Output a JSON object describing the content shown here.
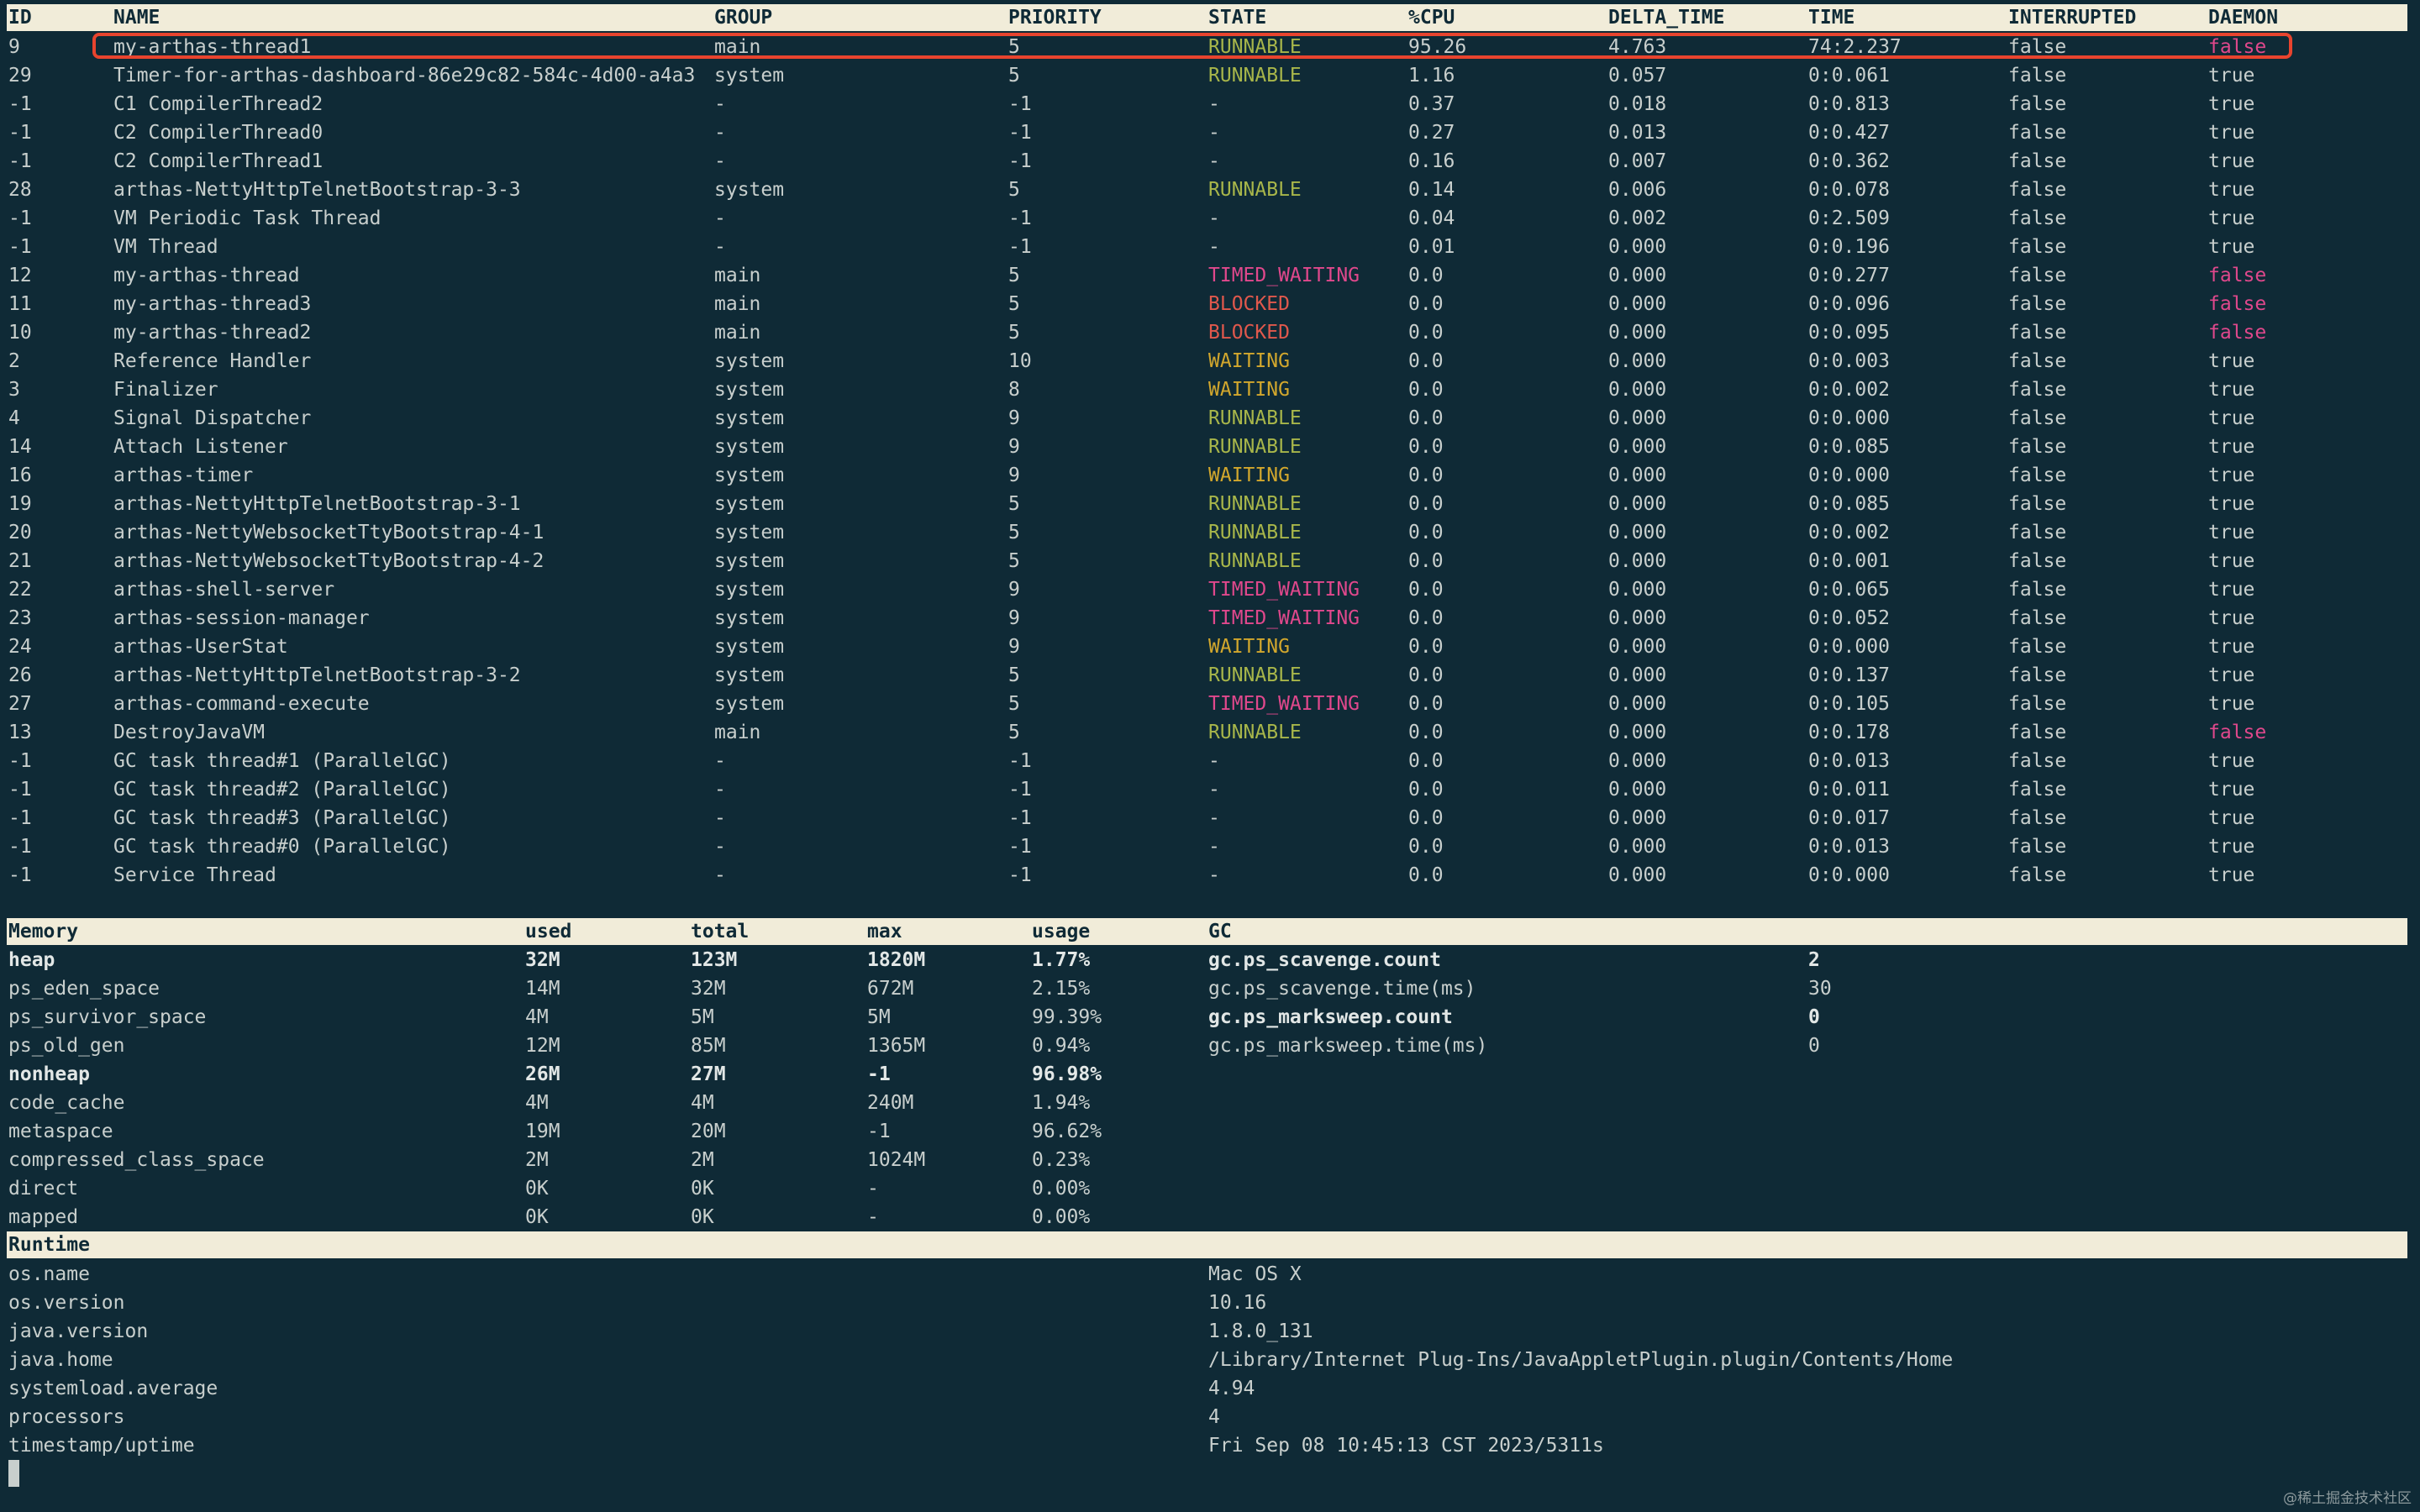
{
  "thread_table": {
    "headers": {
      "id": "ID",
      "name": "NAME",
      "group": "GROUP",
      "priority": "PRIORITY",
      "state": "STATE",
      "cpu": "%CPU",
      "delta_time": "DELTA_TIME",
      "time": "TIME",
      "interrupted": "INTERRUPTED",
      "daemon": "DAEMON"
    },
    "selected_row_index": 0,
    "rows": [
      {
        "id": "9",
        "name": "my-arthas-thread1",
        "group": "main",
        "priority": "5",
        "state": "RUNNABLE",
        "cpu": "95.26",
        "delta_time": "4.763",
        "time": "74:2.237",
        "interrupted": "false",
        "daemon": "false"
      },
      {
        "id": "29",
        "name": "Timer-for-arthas-dashboard-86e29c82-584c-4d00-a4a3",
        "group": "system",
        "priority": "5",
        "state": "RUNNABLE",
        "cpu": "1.16",
        "delta_time": "0.057",
        "time": "0:0.061",
        "interrupted": "false",
        "daemon": "true"
      },
      {
        "id": "-1",
        "name": "C1 CompilerThread2",
        "group": "-",
        "priority": "-1",
        "state": "-",
        "cpu": "0.37",
        "delta_time": "0.018",
        "time": "0:0.813",
        "interrupted": "false",
        "daemon": "true"
      },
      {
        "id": "-1",
        "name": "C2 CompilerThread0",
        "group": "-",
        "priority": "-1",
        "state": "-",
        "cpu": "0.27",
        "delta_time": "0.013",
        "time": "0:0.427",
        "interrupted": "false",
        "daemon": "true"
      },
      {
        "id": "-1",
        "name": "C2 CompilerThread1",
        "group": "-",
        "priority": "-1",
        "state": "-",
        "cpu": "0.16",
        "delta_time": "0.007",
        "time": "0:0.362",
        "interrupted": "false",
        "daemon": "true"
      },
      {
        "id": "28",
        "name": "arthas-NettyHttpTelnetBootstrap-3-3",
        "group": "system",
        "priority": "5",
        "state": "RUNNABLE",
        "cpu": "0.14",
        "delta_time": "0.006",
        "time": "0:0.078",
        "interrupted": "false",
        "daemon": "true"
      },
      {
        "id": "-1",
        "name": "VM Periodic Task Thread",
        "group": "-",
        "priority": "-1",
        "state": "-",
        "cpu": "0.04",
        "delta_time": "0.002",
        "time": "0:2.509",
        "interrupted": "false",
        "daemon": "true"
      },
      {
        "id": "-1",
        "name": "VM Thread",
        "group": "-",
        "priority": "-1",
        "state": "-",
        "cpu": "0.01",
        "delta_time": "0.000",
        "time": "0:0.196",
        "interrupted": "false",
        "daemon": "true"
      },
      {
        "id": "12",
        "name": "my-arthas-thread",
        "group": "main",
        "priority": "5",
        "state": "TIMED_WAITING",
        "cpu": "0.0",
        "delta_time": "0.000",
        "time": "0:0.277",
        "interrupted": "false",
        "daemon": "false"
      },
      {
        "id": "11",
        "name": "my-arthas-thread3",
        "group": "main",
        "priority": "5",
        "state": "BLOCKED",
        "cpu": "0.0",
        "delta_time": "0.000",
        "time": "0:0.096",
        "interrupted": "false",
        "daemon": "false"
      },
      {
        "id": "10",
        "name": "my-arthas-thread2",
        "group": "main",
        "priority": "5",
        "state": "BLOCKED",
        "cpu": "0.0",
        "delta_time": "0.000",
        "time": "0:0.095",
        "interrupted": "false",
        "daemon": "false"
      },
      {
        "id": "2",
        "name": "Reference Handler",
        "group": "system",
        "priority": "10",
        "state": "WAITING",
        "cpu": "0.0",
        "delta_time": "0.000",
        "time": "0:0.003",
        "interrupted": "false",
        "daemon": "true"
      },
      {
        "id": "3",
        "name": "Finalizer",
        "group": "system",
        "priority": "8",
        "state": "WAITING",
        "cpu": "0.0",
        "delta_time": "0.000",
        "time": "0:0.002",
        "interrupted": "false",
        "daemon": "true"
      },
      {
        "id": "4",
        "name": "Signal Dispatcher",
        "group": "system",
        "priority": "9",
        "state": "RUNNABLE",
        "cpu": "0.0",
        "delta_time": "0.000",
        "time": "0:0.000",
        "interrupted": "false",
        "daemon": "true"
      },
      {
        "id": "14",
        "name": "Attach Listener",
        "group": "system",
        "priority": "9",
        "state": "RUNNABLE",
        "cpu": "0.0",
        "delta_time": "0.000",
        "time": "0:0.085",
        "interrupted": "false",
        "daemon": "true"
      },
      {
        "id": "16",
        "name": "arthas-timer",
        "group": "system",
        "priority": "9",
        "state": "WAITING",
        "cpu": "0.0",
        "delta_time": "0.000",
        "time": "0:0.000",
        "interrupted": "false",
        "daemon": "true"
      },
      {
        "id": "19",
        "name": "arthas-NettyHttpTelnetBootstrap-3-1",
        "group": "system",
        "priority": "5",
        "state": "RUNNABLE",
        "cpu": "0.0",
        "delta_time": "0.000",
        "time": "0:0.085",
        "interrupted": "false",
        "daemon": "true"
      },
      {
        "id": "20",
        "name": "arthas-NettyWebsocketTtyBootstrap-4-1",
        "group": "system",
        "priority": "5",
        "state": "RUNNABLE",
        "cpu": "0.0",
        "delta_time": "0.000",
        "time": "0:0.002",
        "interrupted": "false",
        "daemon": "true"
      },
      {
        "id": "21",
        "name": "arthas-NettyWebsocketTtyBootstrap-4-2",
        "group": "system",
        "priority": "5",
        "state": "RUNNABLE",
        "cpu": "0.0",
        "delta_time": "0.000",
        "time": "0:0.001",
        "interrupted": "false",
        "daemon": "true"
      },
      {
        "id": "22",
        "name": "arthas-shell-server",
        "group": "system",
        "priority": "9",
        "state": "TIMED_WAITING",
        "cpu": "0.0",
        "delta_time": "0.000",
        "time": "0:0.065",
        "interrupted": "false",
        "daemon": "true"
      },
      {
        "id": "23",
        "name": "arthas-session-manager",
        "group": "system",
        "priority": "9",
        "state": "TIMED_WAITING",
        "cpu": "0.0",
        "delta_time": "0.000",
        "time": "0:0.052",
        "interrupted": "false",
        "daemon": "true"
      },
      {
        "id": "24",
        "name": "arthas-UserStat",
        "group": "system",
        "priority": "9",
        "state": "WAITING",
        "cpu": "0.0",
        "delta_time": "0.000",
        "time": "0:0.000",
        "interrupted": "false",
        "daemon": "true"
      },
      {
        "id": "26",
        "name": "arthas-NettyHttpTelnetBootstrap-3-2",
        "group": "system",
        "priority": "5",
        "state": "RUNNABLE",
        "cpu": "0.0",
        "delta_time": "0.000",
        "time": "0:0.137",
        "interrupted": "false",
        "daemon": "true"
      },
      {
        "id": "27",
        "name": "arthas-command-execute",
        "group": "system",
        "priority": "5",
        "state": "TIMED_WAITING",
        "cpu": "0.0",
        "delta_time": "0.000",
        "time": "0:0.105",
        "interrupted": "false",
        "daemon": "true"
      },
      {
        "id": "13",
        "name": "DestroyJavaVM",
        "group": "main",
        "priority": "5",
        "state": "RUNNABLE",
        "cpu": "0.0",
        "delta_time": "0.000",
        "time": "0:0.178",
        "interrupted": "false",
        "daemon": "false"
      },
      {
        "id": "-1",
        "name": "GC task thread#1 (ParallelGC)",
        "group": "-",
        "priority": "-1",
        "state": "-",
        "cpu": "0.0",
        "delta_time": "0.000",
        "time": "0:0.013",
        "interrupted": "false",
        "daemon": "true"
      },
      {
        "id": "-1",
        "name": "GC task thread#2 (ParallelGC)",
        "group": "-",
        "priority": "-1",
        "state": "-",
        "cpu": "0.0",
        "delta_time": "0.000",
        "time": "0:0.011",
        "interrupted": "false",
        "daemon": "true"
      },
      {
        "id": "-1",
        "name": "GC task thread#3 (ParallelGC)",
        "group": "-",
        "priority": "-1",
        "state": "-",
        "cpu": "0.0",
        "delta_time": "0.000",
        "time": "0:0.017",
        "interrupted": "false",
        "daemon": "true"
      },
      {
        "id": "-1",
        "name": "GC task thread#0 (ParallelGC)",
        "group": "-",
        "priority": "-1",
        "state": "-",
        "cpu": "0.0",
        "delta_time": "0.000",
        "time": "0:0.013",
        "interrupted": "false",
        "daemon": "true"
      },
      {
        "id": "-1",
        "name": "Service Thread",
        "group": "-",
        "priority": "-1",
        "state": "-",
        "cpu": "0.0",
        "delta_time": "0.000",
        "time": "0:0.000",
        "interrupted": "false",
        "daemon": "true"
      }
    ]
  },
  "memory_table": {
    "headers": {
      "memory": "Memory",
      "used": "used",
      "total": "total",
      "max": "max",
      "usage": "usage"
    },
    "rows": [
      {
        "name": "heap",
        "used": "32M",
        "total": "123M",
        "max": "1820M",
        "usage": "1.77%",
        "bold": true
      },
      {
        "name": "ps_eden_space",
        "used": "14M",
        "total": "32M",
        "max": "672M",
        "usage": "2.15%",
        "bold": false
      },
      {
        "name": "ps_survivor_space",
        "used": "4M",
        "total": "5M",
        "max": "5M",
        "usage": "99.39%",
        "bold": false
      },
      {
        "name": "ps_old_gen",
        "used": "12M",
        "total": "85M",
        "max": "1365M",
        "usage": "0.94%",
        "bold": false
      },
      {
        "name": "nonheap",
        "used": "26M",
        "total": "27M",
        "max": "-1",
        "usage": "96.98%",
        "bold": true
      },
      {
        "name": "code_cache",
        "used": "4M",
        "total": "4M",
        "max": "240M",
        "usage": "1.94%",
        "bold": false
      },
      {
        "name": "metaspace",
        "used": "19M",
        "total": "20M",
        "max": "-1",
        "usage": "96.62%",
        "bold": false
      },
      {
        "name": "compressed_class_space",
        "used": "2M",
        "total": "2M",
        "max": "1024M",
        "usage": "0.23%",
        "bold": false
      },
      {
        "name": "direct",
        "used": "0K",
        "total": "0K",
        "max": "-",
        "usage": "0.00%",
        "bold": false
      },
      {
        "name": "mapped",
        "used": "0K",
        "total": "0K",
        "max": "-",
        "usage": "0.00%",
        "bold": false
      }
    ]
  },
  "gc_table": {
    "header": "GC",
    "rows": [
      {
        "name": "gc.ps_scavenge.count",
        "value": "2",
        "bold": true
      },
      {
        "name": "gc.ps_scavenge.time(ms)",
        "value": "30",
        "bold": false
      },
      {
        "name": "gc.ps_marksweep.count",
        "value": "0",
        "bold": true
      },
      {
        "name": "gc.ps_marksweep.time(ms)",
        "value": "0",
        "bold": false
      }
    ]
  },
  "runtime_table": {
    "header": "Runtime",
    "rows": [
      {
        "name": "os.name",
        "value": "Mac OS X"
      },
      {
        "name": "os.version",
        "value": "10.16"
      },
      {
        "name": "java.version",
        "value": "1.8.0_131"
      },
      {
        "name": "java.home",
        "value": "/Library/Internet Plug-Ins/JavaAppletPlugin.plugin/Contents/Home"
      },
      {
        "name": "systemload.average",
        "value": "4.94"
      },
      {
        "name": "processors",
        "value": "4"
      },
      {
        "name": "timestamp/uptime",
        "value": "Fri Sep 08 10:45:13 CST 2023/5311s"
      }
    ]
  },
  "watermark": "@稀土掘金技术社区",
  "colors": {
    "background": "#0f2a36",
    "header_bg": "#f1ecd9",
    "text": "#c8cfcd",
    "runnable": "#a8b64a",
    "timed_waiting": "#e0488c",
    "waiting": "#d2a72d",
    "blocked": "#e0584c",
    "daemon_false": "#e0488c",
    "highlight_border": "#e8442e"
  }
}
